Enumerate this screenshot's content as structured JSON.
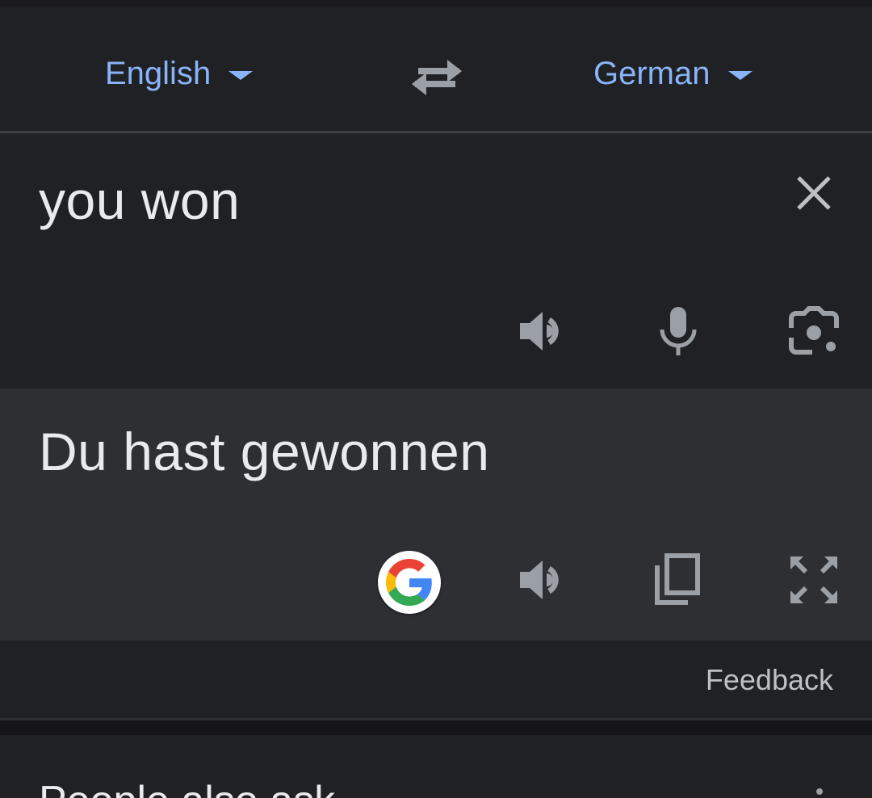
{
  "languages": {
    "source": "English",
    "target": "German"
  },
  "source": {
    "text": "you won"
  },
  "translation": {
    "text": "Du hast gewonnen"
  },
  "feedback_label": "Feedback",
  "people_also_ask": {
    "title": "People also ask"
  },
  "colors": {
    "background": "#202124",
    "result_background": "#2e2f33",
    "accent": "#8ab4f8",
    "text": "#e8eaed",
    "icon": "#9aa0a6"
  },
  "icons": {
    "swap": "swap-languages-icon",
    "clear": "close-icon",
    "listen": "speaker-icon",
    "voice": "microphone-icon",
    "camera": "camera-lens-icon",
    "google": "google-g-logo",
    "copy": "copy-icon",
    "fullscreen": "fullscreen-icon",
    "more": "more-options-icon"
  }
}
